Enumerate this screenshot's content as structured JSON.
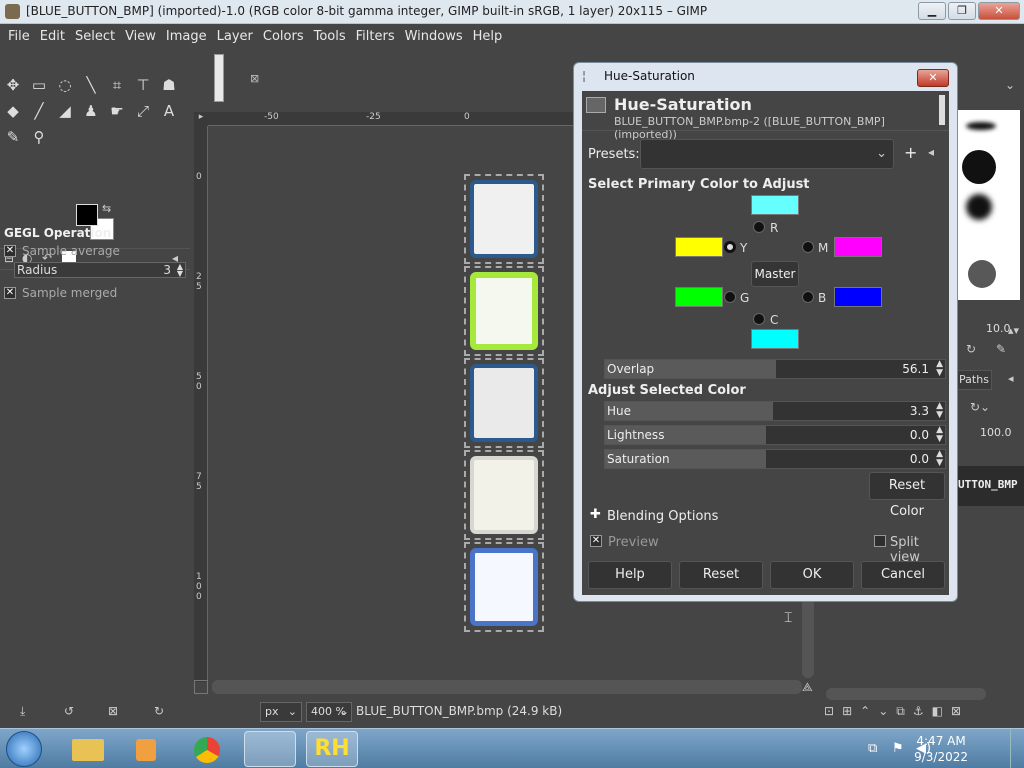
{
  "window": {
    "title": "[BLUE_BUTTON_BMP] (imported)-1.0 (RGB color 8-bit gamma integer, GIMP built-in sRGB, 1 layer) 20x115 – GIMP"
  },
  "menu": [
    "File",
    "Edit",
    "Select",
    "View",
    "Image",
    "Layer",
    "Colors",
    "Tools",
    "Filters",
    "Windows",
    "Help"
  ],
  "toolbox": {
    "panel_title": "GEGL Operation",
    "sample_average": "Sample average",
    "radius_label": "Radius",
    "radius_value": "3",
    "sample_merged": "Sample merged"
  },
  "ruler": {
    "h": [
      "-50",
      "-25",
      "0"
    ],
    "v": [
      "0",
      "2 5",
      "5 0",
      "7 5",
      "1 0 0"
    ]
  },
  "status": {
    "unit": "px",
    "zoom": "400 %",
    "file": "BLUE_BUTTON_BMP.bmp (24.9 kB)"
  },
  "dock": {
    "value1": "10.0",
    "tab_paths": "Paths",
    "value2": "100.0",
    "layer_name": "UTTON_BMP"
  },
  "dialog": {
    "window_title": "Hue-Saturation",
    "heading": "Hue-Saturation",
    "subheading": "BLUE_BUTTON_BMP.bmp-2 ([BLUE_BUTTON_BMP] (imported))",
    "presets_label": "Presets:",
    "primary_label": "Select Primary Color to Adjust",
    "channels": {
      "R": "R",
      "Y": "Y",
      "M": "M",
      "G": "G",
      "B": "B",
      "C": "C"
    },
    "master": "Master",
    "overlap": {
      "label": "Overlap",
      "value": "56.1",
      "fraction": 0.5
    },
    "adjust_label": "Adjust Selected Color",
    "hue": {
      "label": "Hue",
      "value": "3.3",
      "fraction": 0.49
    },
    "lightness": {
      "label": "Lightness",
      "value": "0.0",
      "fraction": 0.47
    },
    "saturation": {
      "label": "Saturation",
      "value": "0.0",
      "fraction": 0.47
    },
    "reset_color": "Reset Color",
    "blending": "Blending Options",
    "preview": "Preview",
    "split_view": "Split view",
    "buttons": {
      "help": "Help",
      "reset": "Reset",
      "ok": "OK",
      "cancel": "Cancel"
    }
  },
  "taskbar": {
    "time": "4:47 AM",
    "date": "9/3/2022"
  },
  "colors": {
    "red": "#ff5555",
    "yellow": "#ffff00",
    "magenta": "#ff00ff",
    "green": "#00ff00",
    "blue": "#0000ff",
    "cyan": "#00ffff",
    "cyan_top": "#66ffff"
  }
}
